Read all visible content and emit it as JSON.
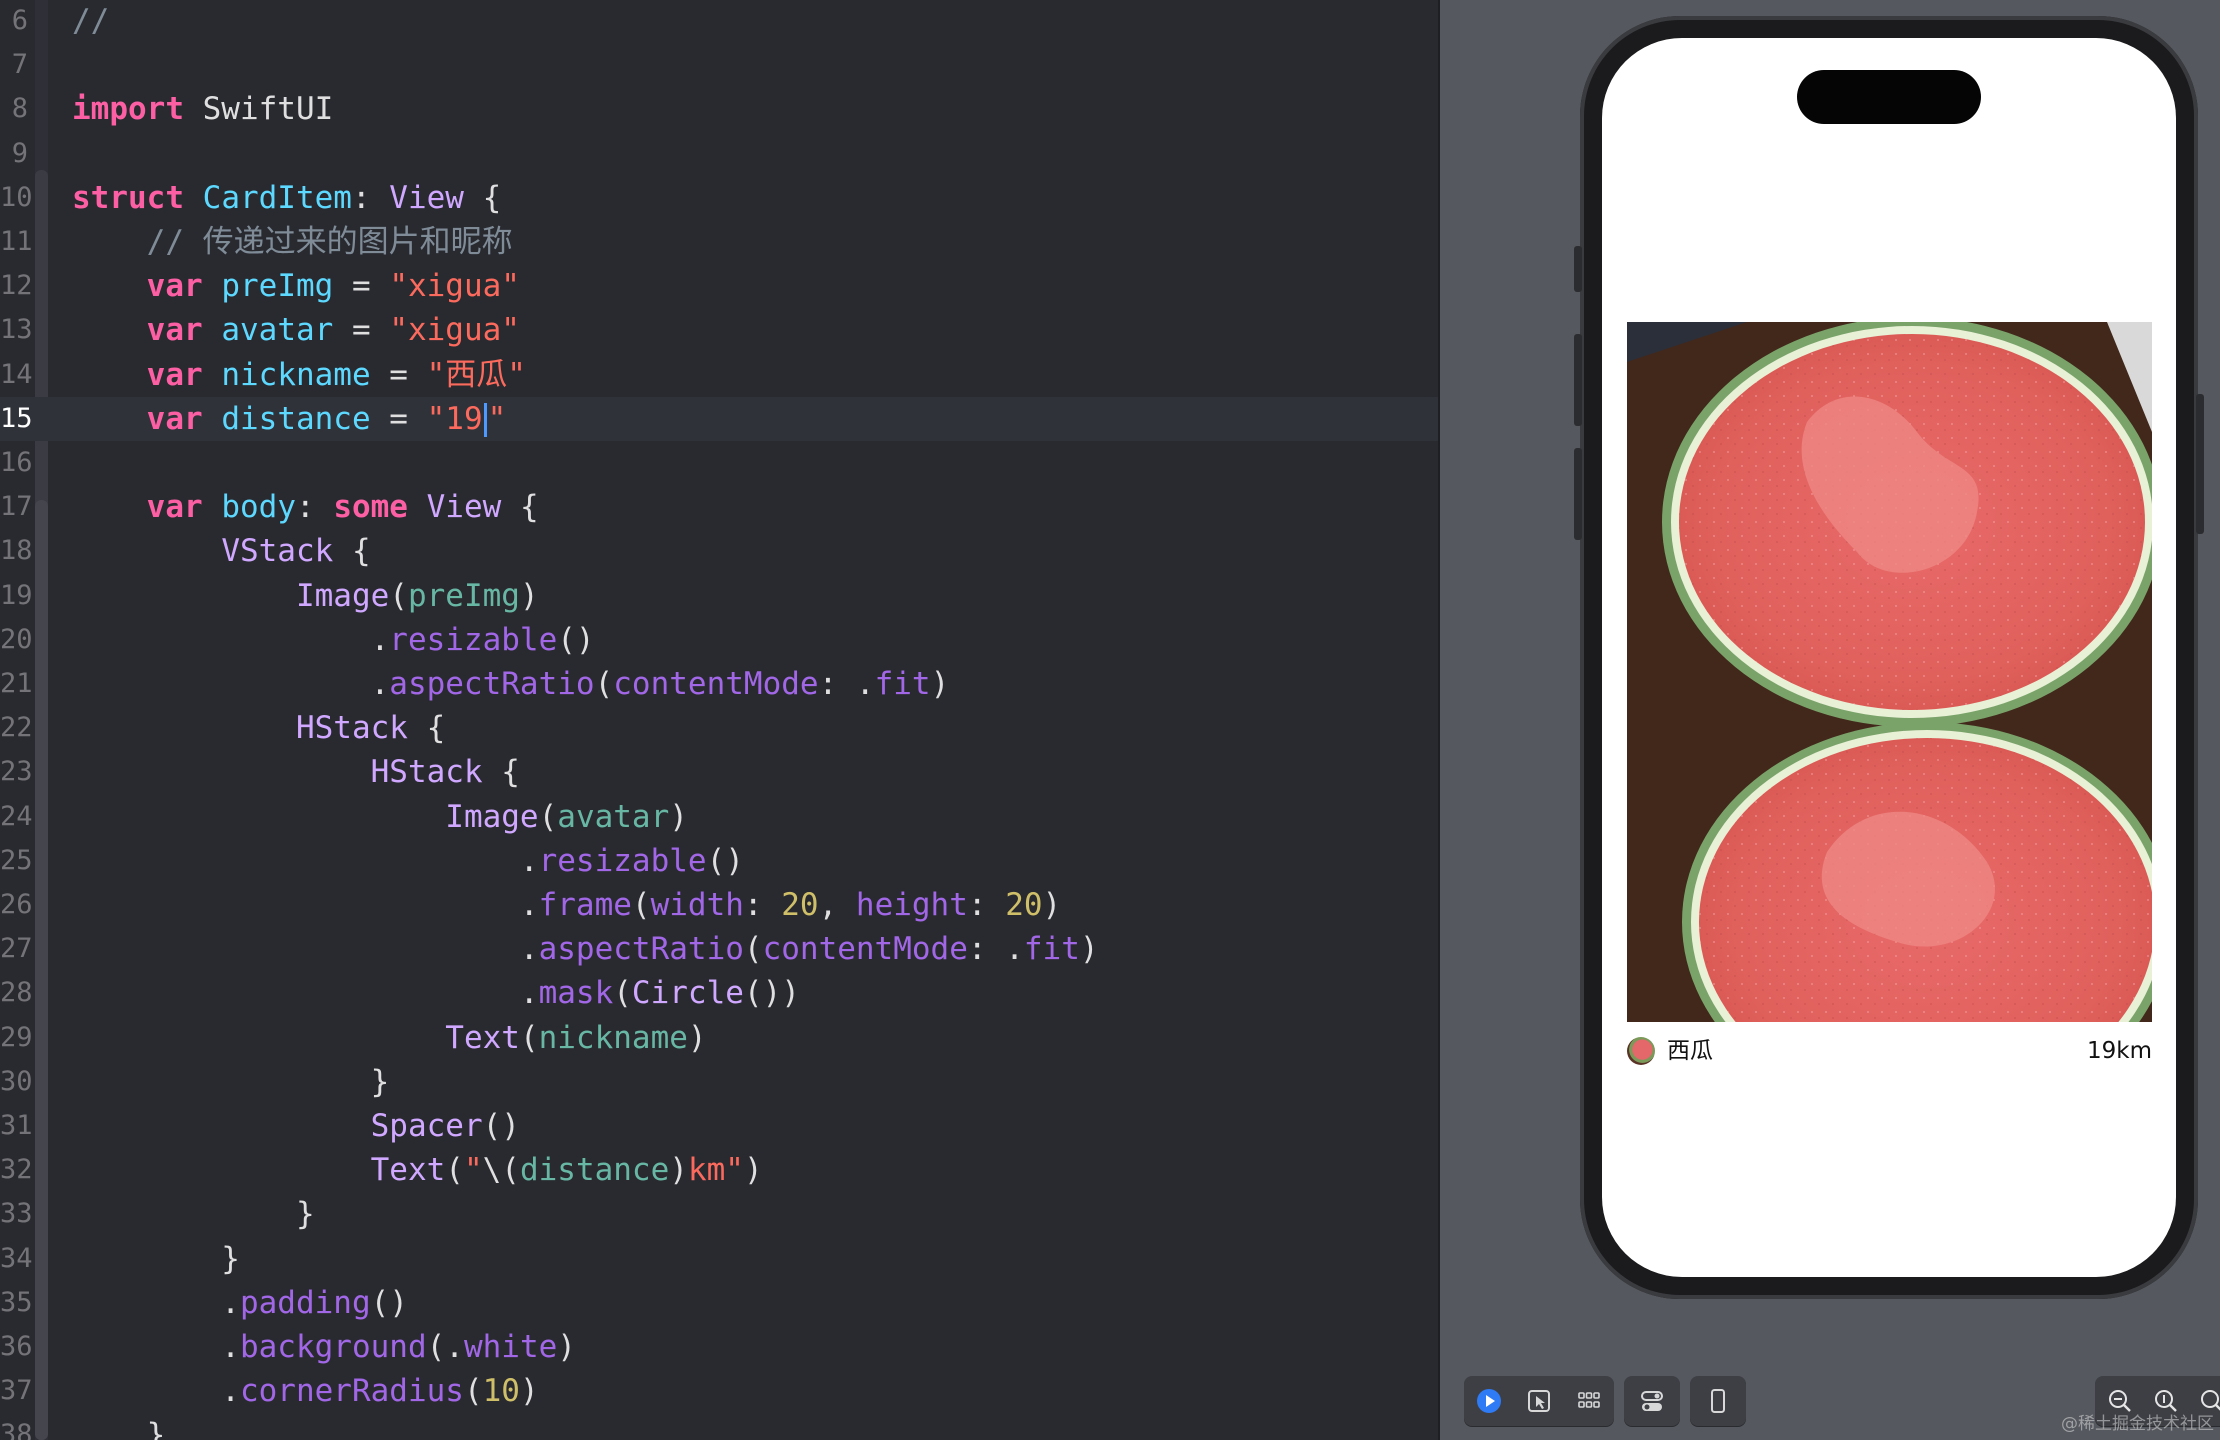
{
  "editor": {
    "lines": [
      {
        "n": "6",
        "current": false,
        "tokens": [
          [
            "cm",
            "//"
          ]
        ]
      },
      {
        "n": "7",
        "current": false,
        "tokens": []
      },
      {
        "n": "8",
        "current": false,
        "tokens": [
          [
            "kw",
            "import"
          ],
          [
            "pl",
            " SwiftUI"
          ]
        ]
      },
      {
        "n": "9",
        "current": false,
        "tokens": []
      },
      {
        "n": "10",
        "current": false,
        "tokens": [
          [
            "kw",
            "struct"
          ],
          [
            "pl",
            " "
          ],
          [
            "ty",
            "CardItem"
          ],
          [
            "pl",
            ": "
          ],
          [
            "sys",
            "View"
          ],
          [
            "pl",
            " {"
          ]
        ]
      },
      {
        "n": "11",
        "current": false,
        "tokens": [
          [
            "cm",
            "    // 传递过来的图片和昵称"
          ]
        ]
      },
      {
        "n": "12",
        "current": false,
        "tokens": [
          [
            "pl",
            "    "
          ],
          [
            "kw",
            "var"
          ],
          [
            "pl",
            " "
          ],
          [
            "ty",
            "preImg"
          ],
          [
            "pl",
            " = "
          ],
          [
            "str",
            "\"xigua\""
          ]
        ]
      },
      {
        "n": "13",
        "current": false,
        "tokens": [
          [
            "pl",
            "    "
          ],
          [
            "kw",
            "var"
          ],
          [
            "pl",
            " "
          ],
          [
            "ty",
            "avatar"
          ],
          [
            "pl",
            " = "
          ],
          [
            "str",
            "\"xigua\""
          ]
        ]
      },
      {
        "n": "14",
        "current": false,
        "tokens": [
          [
            "pl",
            "    "
          ],
          [
            "kw",
            "var"
          ],
          [
            "pl",
            " "
          ],
          [
            "ty",
            "nickname"
          ],
          [
            "pl",
            " = "
          ],
          [
            "str",
            "\"西瓜\""
          ]
        ]
      },
      {
        "n": "15",
        "current": true,
        "tokens": [
          [
            "pl",
            "    "
          ],
          [
            "kw",
            "var"
          ],
          [
            "pl",
            " "
          ],
          [
            "ty",
            "distance"
          ],
          [
            "pl",
            " = "
          ],
          [
            "str",
            "\"19"
          ],
          [
            "caret",
            ""
          ],
          [
            "str",
            "\""
          ]
        ]
      },
      {
        "n": "16",
        "current": false,
        "tokens": []
      },
      {
        "n": "17",
        "current": false,
        "tokens": [
          [
            "pl",
            "    "
          ],
          [
            "kw",
            "var"
          ],
          [
            "pl",
            " "
          ],
          [
            "ty",
            "body"
          ],
          [
            "pl",
            ": "
          ],
          [
            "kw",
            "some"
          ],
          [
            "pl",
            " "
          ],
          [
            "sys",
            "View"
          ],
          [
            "pl",
            " {"
          ]
        ]
      },
      {
        "n": "18",
        "current": false,
        "tokens": [
          [
            "pl",
            "        "
          ],
          [
            "sys",
            "VStack"
          ],
          [
            "pl",
            " {"
          ]
        ]
      },
      {
        "n": "19",
        "current": false,
        "tokens": [
          [
            "pl",
            "            "
          ],
          [
            "sys",
            "Image"
          ],
          [
            "pl",
            "("
          ],
          [
            "var",
            "preImg"
          ],
          [
            "pl",
            ")"
          ]
        ]
      },
      {
        "n": "20",
        "current": false,
        "tokens": [
          [
            "pl",
            "                ."
          ],
          [
            "fn",
            "resizable"
          ],
          [
            "pl",
            "()"
          ]
        ]
      },
      {
        "n": "21",
        "current": false,
        "tokens": [
          [
            "pl",
            "                ."
          ],
          [
            "fn",
            "aspectRatio"
          ],
          [
            "pl",
            "("
          ],
          [
            "fn",
            "contentMode"
          ],
          [
            "pl",
            ": ."
          ],
          [
            "fn",
            "fit"
          ],
          [
            "pl",
            ")"
          ]
        ]
      },
      {
        "n": "22",
        "current": false,
        "tokens": [
          [
            "pl",
            "            "
          ],
          [
            "sys",
            "HStack"
          ],
          [
            "pl",
            " {"
          ]
        ]
      },
      {
        "n": "23",
        "current": false,
        "tokens": [
          [
            "pl",
            "                "
          ],
          [
            "sys",
            "HStack"
          ],
          [
            "pl",
            " {"
          ]
        ]
      },
      {
        "n": "24",
        "current": false,
        "tokens": [
          [
            "pl",
            "                    "
          ],
          [
            "sys",
            "Image"
          ],
          [
            "pl",
            "("
          ],
          [
            "var",
            "avatar"
          ],
          [
            "pl",
            ")"
          ]
        ]
      },
      {
        "n": "25",
        "current": false,
        "tokens": [
          [
            "pl",
            "                        ."
          ],
          [
            "fn",
            "resizable"
          ],
          [
            "pl",
            "()"
          ]
        ]
      },
      {
        "n": "26",
        "current": false,
        "tokens": [
          [
            "pl",
            "                        ."
          ],
          [
            "fn",
            "frame"
          ],
          [
            "pl",
            "("
          ],
          [
            "fn",
            "width"
          ],
          [
            "pl",
            ": "
          ],
          [
            "num",
            "20"
          ],
          [
            "pl",
            ", "
          ],
          [
            "fn",
            "height"
          ],
          [
            "pl",
            ": "
          ],
          [
            "num",
            "20"
          ],
          [
            "pl",
            ")"
          ]
        ]
      },
      {
        "n": "27",
        "current": false,
        "tokens": [
          [
            "pl",
            "                        ."
          ],
          [
            "fn",
            "aspectRatio"
          ],
          [
            "pl",
            "("
          ],
          [
            "fn",
            "contentMode"
          ],
          [
            "pl",
            ": ."
          ],
          [
            "fn",
            "fit"
          ],
          [
            "pl",
            ")"
          ]
        ]
      },
      {
        "n": "28",
        "current": false,
        "tokens": [
          [
            "pl",
            "                        ."
          ],
          [
            "fn",
            "mask"
          ],
          [
            "pl",
            "("
          ],
          [
            "sys",
            "Circle"
          ],
          [
            "pl",
            "())"
          ]
        ]
      },
      {
        "n": "29",
        "current": false,
        "tokens": [
          [
            "pl",
            "                    "
          ],
          [
            "sys",
            "Text"
          ],
          [
            "pl",
            "("
          ],
          [
            "var",
            "nickname"
          ],
          [
            "pl",
            ")"
          ]
        ]
      },
      {
        "n": "30",
        "current": false,
        "tokens": [
          [
            "pl",
            "                }"
          ]
        ]
      },
      {
        "n": "31",
        "current": false,
        "tokens": [
          [
            "pl",
            "                "
          ],
          [
            "sys",
            "Spacer"
          ],
          [
            "pl",
            "()"
          ]
        ]
      },
      {
        "n": "32",
        "current": false,
        "tokens": [
          [
            "pl",
            "                "
          ],
          [
            "sys",
            "Text"
          ],
          [
            "pl",
            "("
          ],
          [
            "str",
            "\""
          ],
          [
            "pl",
            "\\("
          ],
          [
            "var",
            "distance"
          ],
          [
            "pl",
            ")"
          ],
          [
            "str",
            "km\""
          ],
          [
            "pl",
            ")"
          ]
        ]
      },
      {
        "n": "33",
        "current": false,
        "tokens": [
          [
            "pl",
            "            }"
          ]
        ]
      },
      {
        "n": "34",
        "current": false,
        "tokens": [
          [
            "pl",
            "        }"
          ]
        ]
      },
      {
        "n": "35",
        "current": false,
        "tokens": [
          [
            "pl",
            "        ."
          ],
          [
            "fn",
            "padding"
          ],
          [
            "pl",
            "()"
          ]
        ]
      },
      {
        "n": "36",
        "current": false,
        "tokens": [
          [
            "pl",
            "        ."
          ],
          [
            "fn",
            "background"
          ],
          [
            "pl",
            "(."
          ],
          [
            "fn",
            "white"
          ],
          [
            "pl",
            ")"
          ]
        ]
      },
      {
        "n": "37",
        "current": false,
        "tokens": [
          [
            "pl",
            "        ."
          ],
          [
            "fn",
            "cornerRadius"
          ],
          [
            "pl",
            "("
          ],
          [
            "num",
            "10"
          ],
          [
            "pl",
            ")"
          ]
        ]
      },
      {
        "n": "38",
        "current": false,
        "tokens": [
          [
            "pl",
            "    }"
          ]
        ]
      }
    ]
  },
  "preview": {
    "nickname": "西瓜",
    "distance": "19km"
  },
  "toolbar": {
    "icons": [
      "live-preview-icon",
      "selectable-icon",
      "variants-grid-icon",
      "device-settings-icon",
      "device-icon",
      "zoom-out-icon",
      "zoom-100-icon",
      "zoom-fit-icon"
    ]
  },
  "watermark": "@稀土掘金技术社区",
  "colors": {
    "editor_bg": "#292a30",
    "keyword": "#fc5fa3",
    "type": "#5dd8ff",
    "string": "#fc6a5d",
    "comment": "#7f8c98",
    "number": "#d0bf69",
    "canvas_bg": "#55585e",
    "accent": "#2f7bf5"
  }
}
